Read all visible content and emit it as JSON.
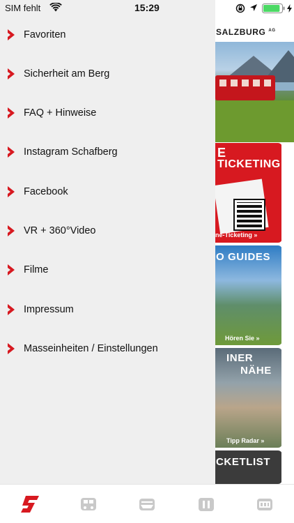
{
  "status_bar": {
    "carrier": "SIM fehlt",
    "time": "15:29",
    "battery_level": 0.9,
    "icons": [
      "wifi-icon",
      "rotation-lock-icon",
      "location-arrow-icon",
      "battery-icon",
      "charging-bolt-icon"
    ]
  },
  "menu": {
    "items": [
      {
        "label": "Favoriten",
        "icon": "chevron-right-icon"
      },
      {
        "label": "Sicherheit am Berg",
        "icon": "chevron-right-icon"
      },
      {
        "label": "FAQ + Hinweise",
        "icon": "chevron-right-icon"
      },
      {
        "label": "Instagram Schafberg",
        "icon": "chevron-right-icon"
      },
      {
        "label": "Facebook",
        "icon": "chevron-right-icon"
      },
      {
        "label": "VR + 360°Video",
        "icon": "chevron-right-icon"
      },
      {
        "label": "Filme",
        "icon": "chevron-right-icon"
      },
      {
        "label": "Impressum",
        "icon": "chevron-right-icon"
      },
      {
        "label": "Masseinheiten / Einstellungen",
        "icon": "chevron-right-icon"
      }
    ]
  },
  "background": {
    "brand": "SALZBURG",
    "brand_suffix": "AG",
    "tiles": [
      {
        "title_line1": "E",
        "title_line2": "TICKETING",
        "link": "ne-Ticketing »"
      },
      {
        "title_line1": "O GUIDES",
        "link": "Hören Sie »"
      },
      {
        "title_line1": "INER",
        "title_line2": "NÄHE",
        "link": "Tipp Radar »"
      },
      {
        "title_line1": "CKETLIST"
      }
    ]
  },
  "tabbar": {
    "tabs": [
      {
        "icon": "schafberg-logo-icon",
        "active": true
      },
      {
        "icon": "train-icon",
        "active": false
      },
      {
        "icon": "ship-icon",
        "active": false
      },
      {
        "icon": "ticket-icon",
        "active": false
      },
      {
        "icon": "gallery-icon",
        "active": false
      }
    ]
  },
  "colors": {
    "accent": "#d71920",
    "drawer_bg": "#efefef",
    "battery_green": "#4cd964",
    "tab_inactive": "#bdbdbd"
  }
}
